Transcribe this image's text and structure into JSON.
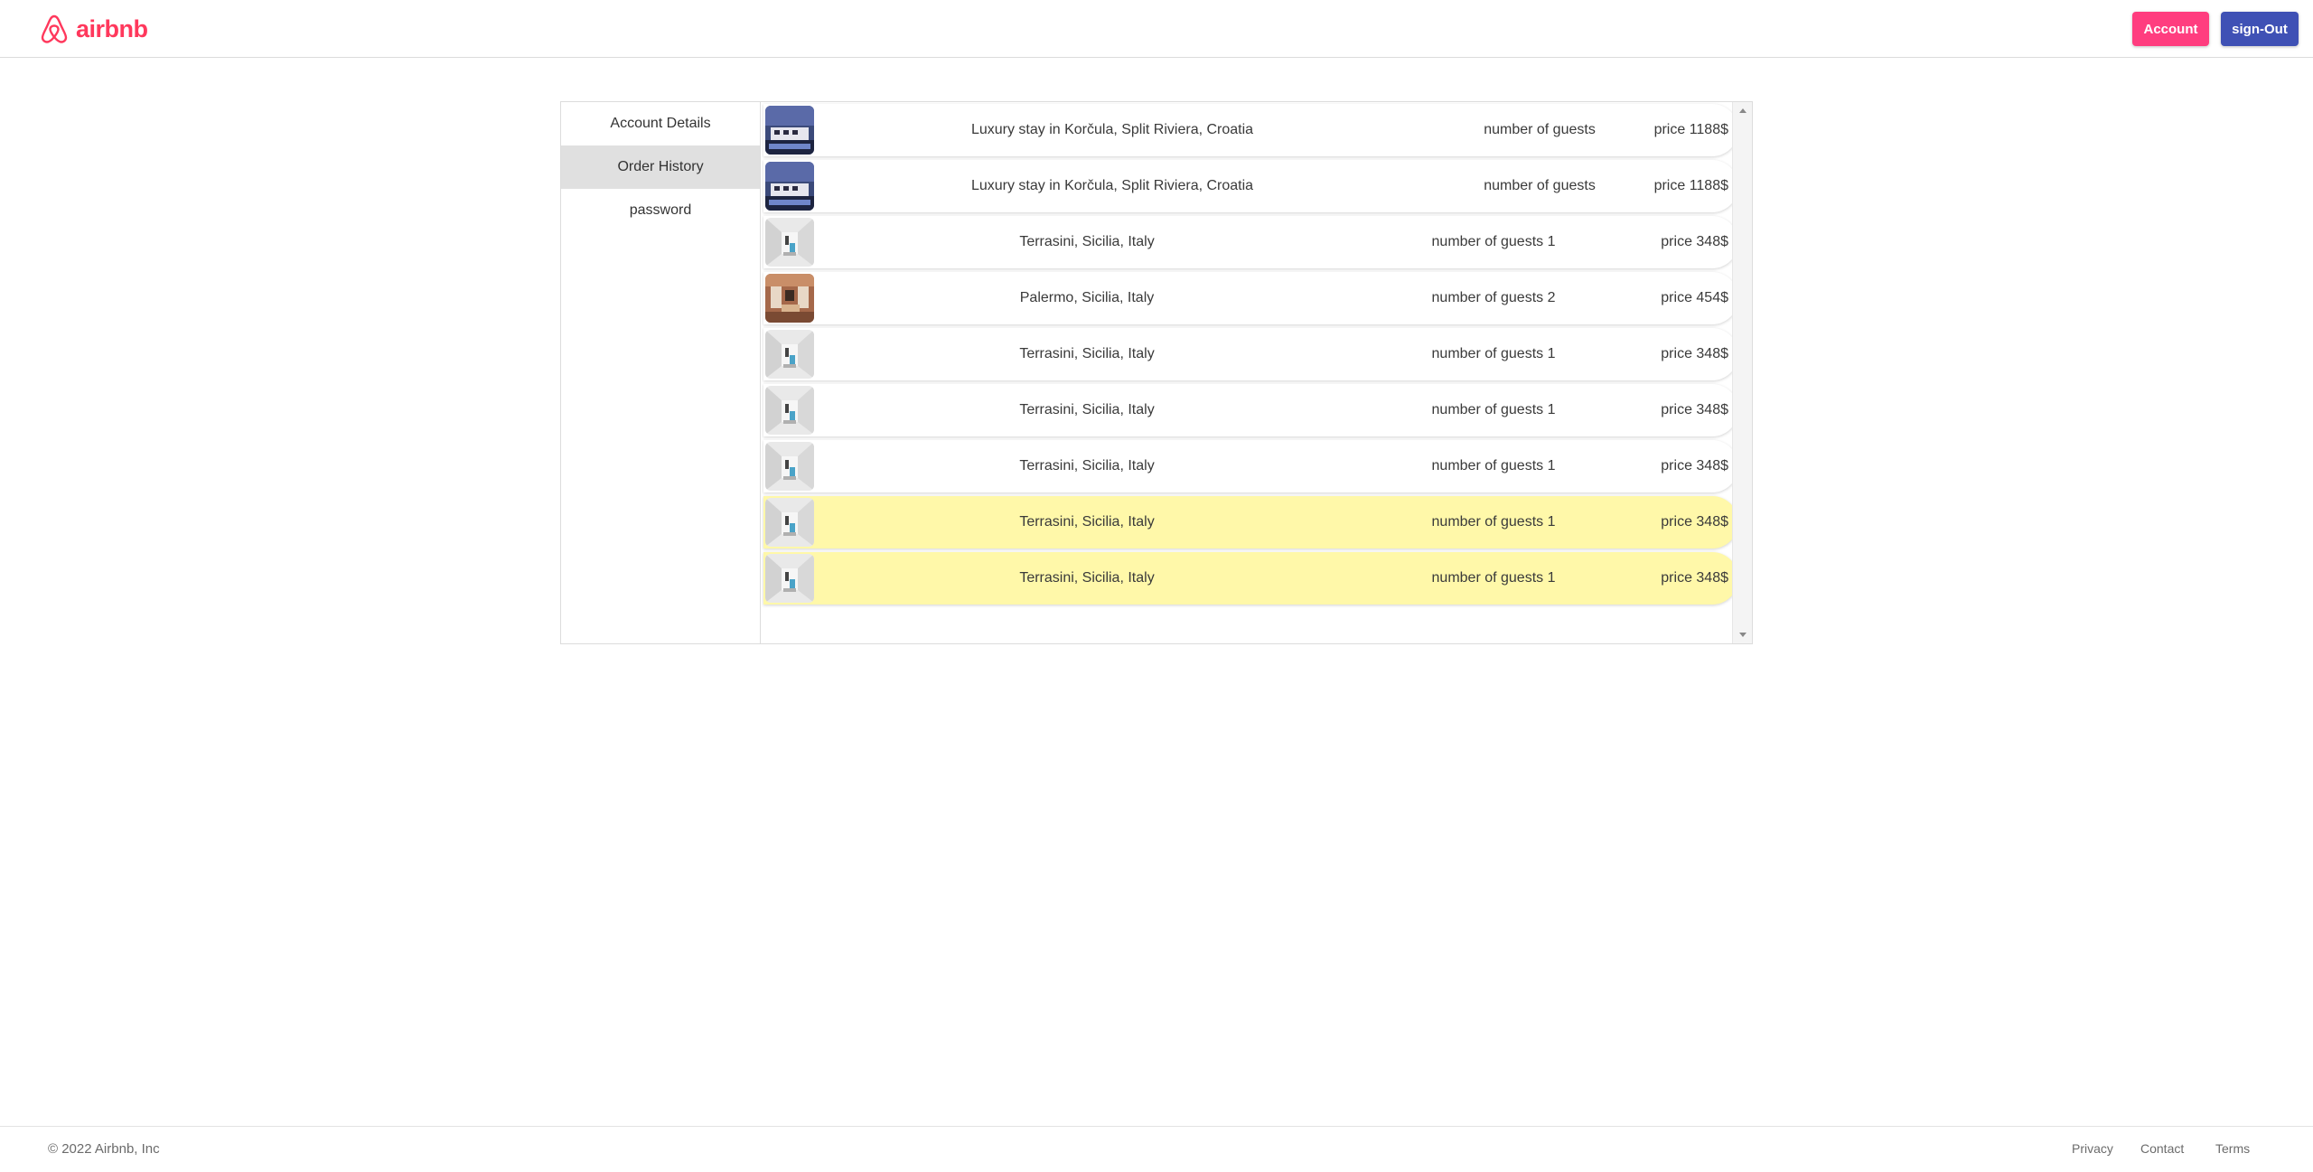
{
  "header": {
    "logo_text": "airbnb",
    "account_label": "Account",
    "signout_label": "sign-Out",
    "brand_color": "#ff385c"
  },
  "sidebar": {
    "items": [
      {
        "label": "Account Details",
        "active": false
      },
      {
        "label": "Order History",
        "active": true
      },
      {
        "label": "password",
        "active": false
      }
    ]
  },
  "orders": [
    {
      "title": "Luxury stay in Korčula, Split Riviera, Croatia",
      "guests": "number of guests",
      "price": "price 1188$",
      "image": "night-villa-photo",
      "highlighted": false
    },
    {
      "title": "Luxury stay in Korčula, Split Riviera, Croatia",
      "guests": "number of guests",
      "price": "price 1188$",
      "image": "night-villa-photo",
      "highlighted": false
    },
    {
      "title": "Terrasini, Sicilia, Italy",
      "guests": "number of guests 1",
      "price": "price 348$",
      "image": "white-room-photo",
      "highlighted": false
    },
    {
      "title": "Palermo, Sicilia, Italy",
      "guests": "number of guests 2",
      "price": "price 454$",
      "image": "warm-interior-photo",
      "highlighted": false
    },
    {
      "title": "Terrasini, Sicilia, Italy",
      "guests": "number of guests 1",
      "price": "price 348$",
      "image": "white-room-photo",
      "highlighted": false
    },
    {
      "title": "Terrasini, Sicilia, Italy",
      "guests": "number of guests 1",
      "price": "price 348$",
      "image": "white-room-photo",
      "highlighted": false
    },
    {
      "title": "Terrasini, Sicilia, Italy",
      "guests": "number of guests 1",
      "price": "price 348$",
      "image": "white-room-photo",
      "highlighted": false
    },
    {
      "title": "Terrasini, Sicilia, Italy",
      "guests": "number of guests 1",
      "price": "price 348$",
      "image": "white-room-photo",
      "highlighted": true
    },
    {
      "title": "Terrasini, Sicilia, Italy",
      "guests": "number of guests 1",
      "price": "price 348$",
      "image": "white-room-photo",
      "highlighted": true
    }
  ],
  "colors": {
    "highlight_row": "#fff8a9",
    "account_button": "#ff3d7f",
    "signout_button": "#3f51b5"
  },
  "footer": {
    "copyright": "© 2022 Airbnb, Inc",
    "links": [
      "Privacy",
      "Contact",
      "Terms"
    ]
  }
}
